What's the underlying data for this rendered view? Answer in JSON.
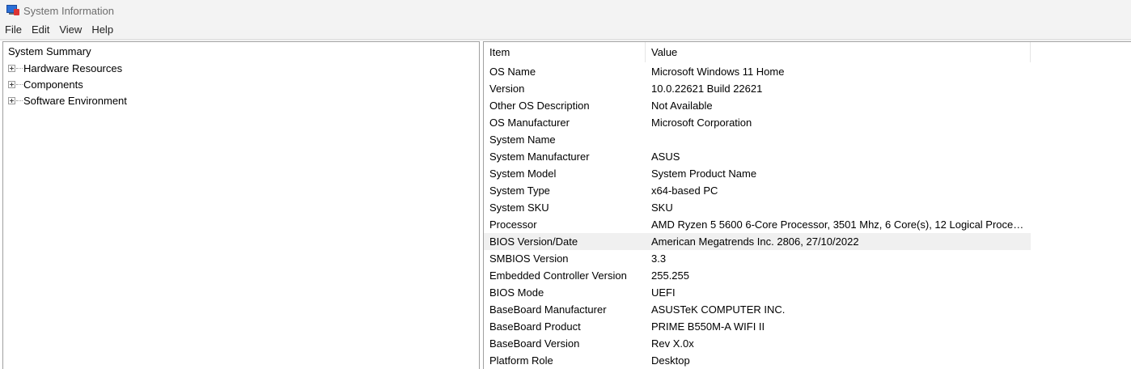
{
  "window": {
    "title": "System Information"
  },
  "menu": [
    "File",
    "Edit",
    "View",
    "Help"
  ],
  "tree": {
    "root": "System Summary",
    "nodes": [
      "Hardware Resources",
      "Components",
      "Software Environment"
    ]
  },
  "list": {
    "columns": [
      "Item",
      "Value"
    ],
    "rows": [
      {
        "item": "OS Name",
        "value": "Microsoft Windows 11 Home"
      },
      {
        "item": "Version",
        "value": "10.0.22621 Build 22621"
      },
      {
        "item": "Other OS Description",
        "value": "Not Available"
      },
      {
        "item": "OS Manufacturer",
        "value": "Microsoft Corporation"
      },
      {
        "item": "System Name",
        "value": ""
      },
      {
        "item": "System Manufacturer",
        "value": "ASUS"
      },
      {
        "item": "System Model",
        "value": "System Product Name"
      },
      {
        "item": "System Type",
        "value": "x64-based PC"
      },
      {
        "item": "System SKU",
        "value": "SKU"
      },
      {
        "item": "Processor",
        "value": "AMD Ryzen 5 5600 6-Core Processor, 3501 Mhz, 6 Core(s), 12 Logical Proces..."
      },
      {
        "item": "BIOS Version/Date",
        "value": "American Megatrends Inc. 2806, 27/10/2022",
        "selected": true
      },
      {
        "item": "SMBIOS Version",
        "value": "3.3"
      },
      {
        "item": "Embedded Controller Version",
        "value": "255.255"
      },
      {
        "item": "BIOS Mode",
        "value": "UEFI"
      },
      {
        "item": "BaseBoard Manufacturer",
        "value": "ASUSTeK COMPUTER INC."
      },
      {
        "item": "BaseBoard Product",
        "value": "PRIME B550M-A WIFI II"
      },
      {
        "item": "BaseBoard Version",
        "value": "Rev X.0x"
      },
      {
        "item": "Platform Role",
        "value": "Desktop"
      }
    ]
  },
  "icons": {
    "app": "system-information-icon",
    "expander": "plus-expander-icon"
  },
  "colors": {
    "selected_row": "#f0f0f0",
    "title_text": "#6d6d6d",
    "chrome": "#f3f3f3"
  }
}
